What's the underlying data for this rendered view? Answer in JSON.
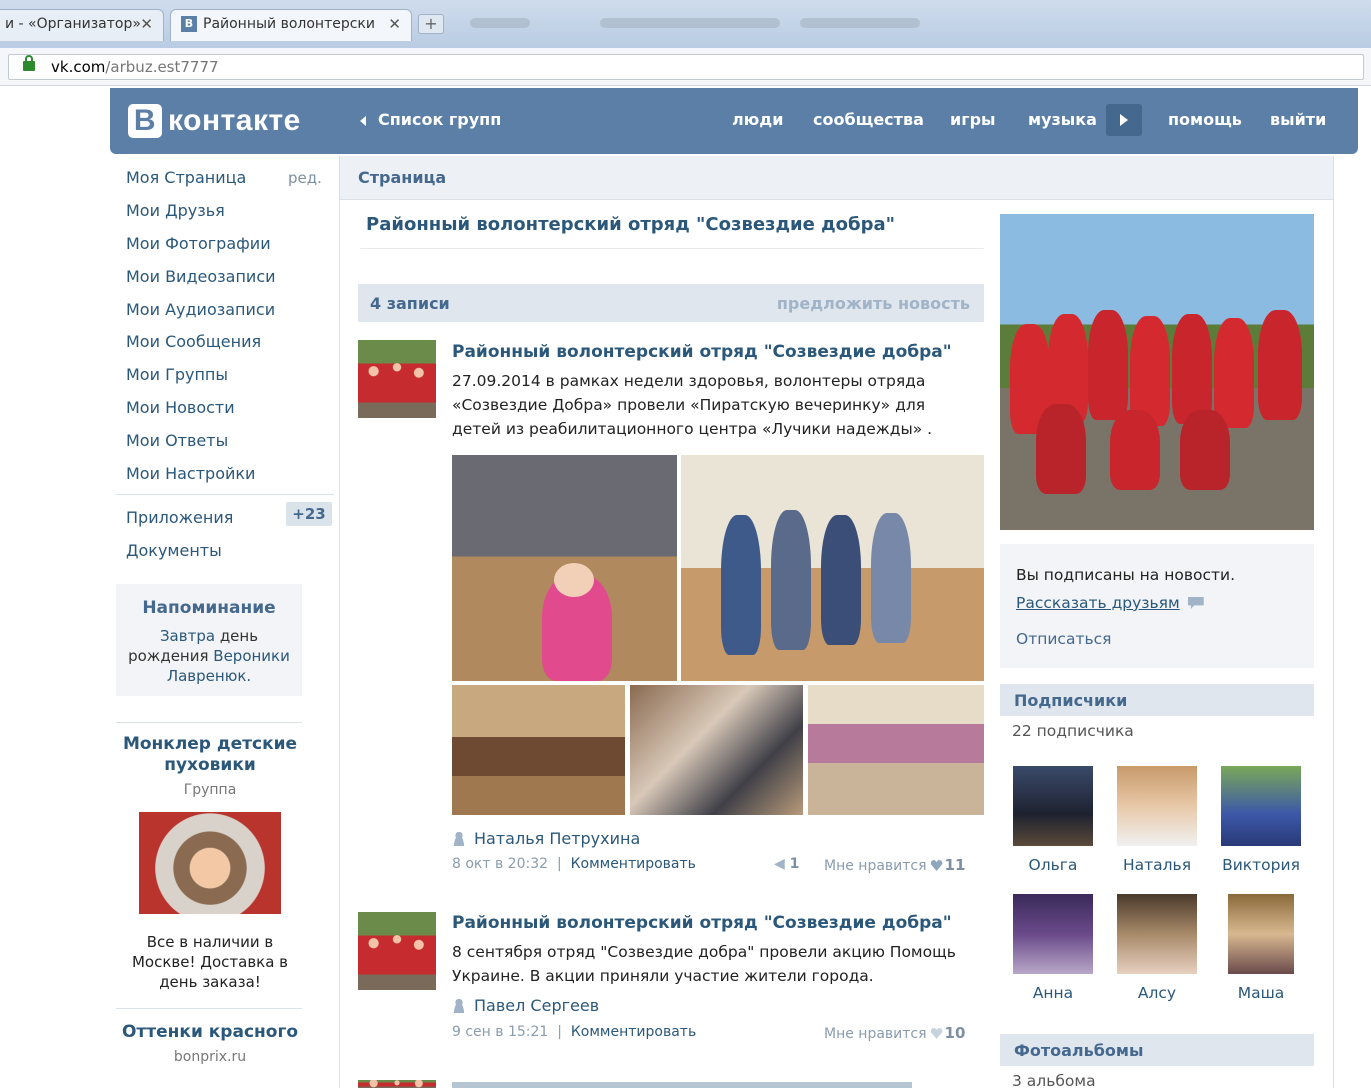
{
  "browser": {
    "tabs": [
      {
        "label": "и - «Организатор»",
        "active": false
      },
      {
        "label": "Районный волонтерски",
        "active": true
      }
    ],
    "favicon_letter": "В",
    "new_tab_symbol": "+",
    "close_symbol": "✕",
    "url_domain": "vk.com",
    "url_path": "/arbuz.est7777"
  },
  "header": {
    "logo_letter": "В",
    "logo_text": "контакте",
    "back_link": "Список групп",
    "nav": [
      "люди",
      "сообщества",
      "игры",
      "музыка",
      "помощь",
      "выйти"
    ]
  },
  "sidebar": {
    "edit_label": "ред.",
    "items": [
      "Моя Страница",
      "Мои Друзья",
      "Мои Фотографии",
      "Мои Видеозаписи",
      "Мои Аудиозаписи",
      "Мои Сообщения",
      "Мои Группы",
      "Мои Новости",
      "Мои Ответы",
      "Мои Настройки"
    ],
    "apps": "Приложения",
    "apps_badge": "+23",
    "docs": "Документы",
    "reminder": {
      "title": "Напоминание",
      "line1_a": "Завтра",
      "line1_b": " день",
      "line2_a": "рождения ",
      "line2_b": "Вероники",
      "line3": "Лавренюк."
    },
    "ad1": {
      "title": "Монклер детские пуховики",
      "subtitle": "Группа",
      "text": "Все в наличии в Москве! Доставка в день заказа!"
    },
    "ad2": {
      "title": "Оттенки красного",
      "source": "bonprix.ru"
    }
  },
  "main": {
    "section_title": "Страница",
    "group_title": "Районный волонтерский отряд \"Созвездие добра\"",
    "wall_count": "4 записи",
    "suggest_news": "предложить новость",
    "posts": [
      {
        "title": "Районный волонтерский отряд \"Созвездие добра\"",
        "text": "27.09.2014 в рамках недели здоровья, волонтеры отряда «Созвездие Добра» провели «Пиратскую вечеринку» для детей из реабилитационного центра «Лучики надежды» .",
        "author": "Наталья Петрухина",
        "date": "8 окт в 20:32",
        "separator": "|",
        "comment": "Комментировать",
        "shares": "1",
        "like_label": "Мне нравится",
        "likes": "11"
      },
      {
        "title": "Районный волонтерский отряд \"Созвездие добра\"",
        "text": "8 сентября отряд \"Созвездие добра\" провели акцию Помощь Украине. В акции приняли участие жители города.",
        "author": "Павел Сергеев",
        "date": "9 сен в 15:21",
        "separator": "|",
        "comment": "Комментировать",
        "like_label": "Мне нравится",
        "likes": "10"
      }
    ]
  },
  "right": {
    "subscribed_text": "Вы подписаны на новости.",
    "tell_friends": "Рассказать друзьям",
    "unsubscribe": "Отписаться",
    "followers_title": "Подписчики",
    "followers_count": "22 подписчика",
    "followers": [
      "Ольга",
      "Наталья",
      "Виктория",
      "Анна",
      "Алсу",
      "Маша"
    ],
    "albums_title": "Фотоальбомы",
    "albums_count": "3 альбома"
  }
}
